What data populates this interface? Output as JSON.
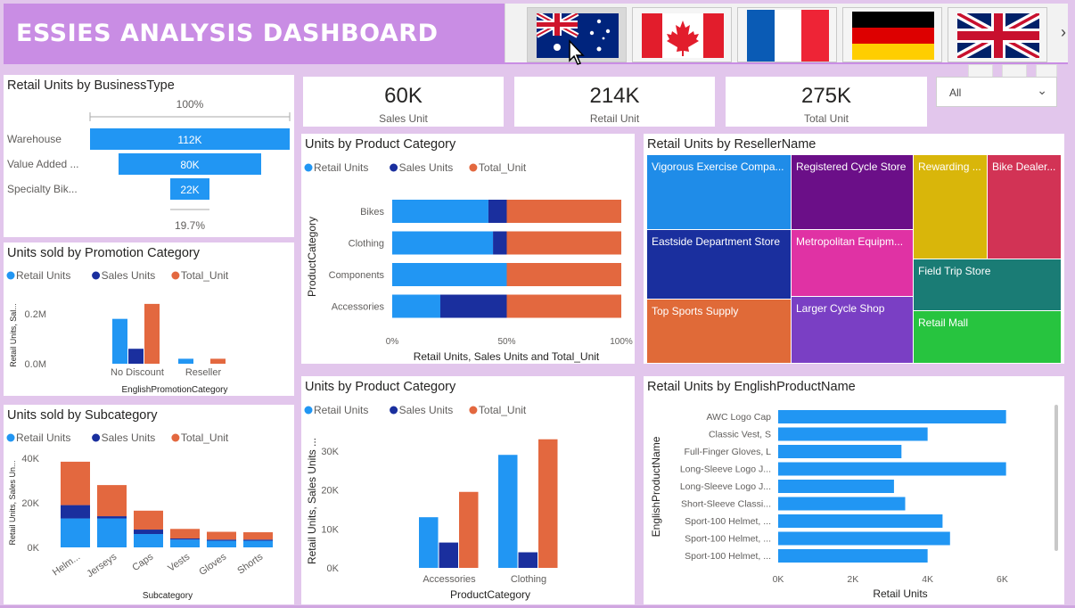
{
  "header": {
    "title": "ESSIES ANALYSIS DASHBOARD"
  },
  "flags": [
    {
      "name": "australia-flag",
      "selected": true
    },
    {
      "name": "canada-flag",
      "selected": false
    },
    {
      "name": "france-flag",
      "selected": false
    },
    {
      "name": "germany-flag",
      "selected": false
    },
    {
      "name": "uk-flag",
      "selected": false
    }
  ],
  "flags_next_icon": "chevron-right-icon",
  "kpis": [
    {
      "value": "60K",
      "label": "Sales Unit"
    },
    {
      "value": "214K",
      "label": "Retail Unit"
    },
    {
      "value": "275K",
      "label": "Total Unit"
    }
  ],
  "slicer": {
    "value": "All"
  },
  "colors": {
    "retail": "#2196f3",
    "sales": "#1a2f9e",
    "total": "#e3683f",
    "card": "#ffffff",
    "header": "#c98de4"
  },
  "legend": {
    "retail": "Retail Units",
    "sales": "Sales Units",
    "total": "Total_Unit"
  },
  "chart_data": [
    {
      "id": "funnel",
      "type": "funnel",
      "title": "Retail Units by BusinessType",
      "categories": [
        "Warehouse",
        "Value Added ...",
        "Specialty Bik..."
      ],
      "values": [
        112,
        80,
        22
      ],
      "value_labels": [
        "112K",
        "80K",
        "22K"
      ],
      "top_label": "100%",
      "bottom_label": "19.7%"
    },
    {
      "id": "promo",
      "type": "bar",
      "title": "Units sold by Promotion Category",
      "categories": [
        "No Discount",
        "Reseller"
      ],
      "series": [
        {
          "name": "Retail Units",
          "values": [
            0.18,
            0.02
          ]
        },
        {
          "name": "Sales Units",
          "values": [
            0.06,
            0.0
          ]
        },
        {
          "name": "Total_Unit",
          "values": [
            0.24,
            0.02
          ]
        }
      ],
      "yticks": [
        "0.0M",
        "0.2M"
      ],
      "ylim": [
        0,
        0.28
      ],
      "xlabel": "EnglishPromotionCategory",
      "ylabel": "Retail Units, Sal..."
    },
    {
      "id": "subcat",
      "type": "bar",
      "stacked": true,
      "title": "Units sold by Subcategory",
      "categories": [
        "Helm...",
        "Jerseys",
        "Caps",
        "Vests",
        "Gloves",
        "Shorts"
      ],
      "series": [
        {
          "name": "Retail Units",
          "values": [
            13000,
            13000,
            6000,
            3500,
            3000,
            3000
          ]
        },
        {
          "name": "Sales Units",
          "values": [
            6000,
            1000,
            2000,
            500,
            500,
            500
          ]
        },
        {
          "name": "Total_Unit",
          "values": [
            19500,
            14000,
            8500,
            4300,
            3500,
            3300
          ]
        }
      ],
      "yticks": [
        "0K",
        "20K",
        "40K"
      ],
      "ylim": [
        0,
        45000
      ],
      "xlabel": "Subcategory",
      "ylabel": "Retail Units, Sales Un..."
    },
    {
      "id": "cat100",
      "type": "bar",
      "orientation": "horizontal",
      "stacked": "100%",
      "title": "Units by Product Category",
      "categories": [
        "Bikes",
        "Clothing",
        "Components",
        "Accessories"
      ],
      "series": [
        {
          "name": "Retail Units",
          "values": [
            42,
            44,
            50,
            21
          ]
        },
        {
          "name": "Sales Units",
          "values": [
            8,
            6,
            0,
            29
          ]
        },
        {
          "name": "Total_Unit",
          "values": [
            50,
            50,
            50,
            50
          ]
        }
      ],
      "xticks": [
        "0%",
        "50%",
        "100%"
      ],
      "xlabel": "Retail Units, Sales Units and Total_Unit",
      "ylabel": "ProductCategory"
    },
    {
      "id": "treemap",
      "type": "treemap",
      "title": "Retail Units by ResellerName",
      "items": [
        {
          "label": "Vigorous Exercise Compa...",
          "color": "#1f8ce8"
        },
        {
          "label": "Eastside Department Store",
          "color": "#1a2f9e"
        },
        {
          "label": "Top Sports Supply",
          "color": "#e06a38"
        },
        {
          "label": "Registered Cycle Store",
          "color": "#6b0f88"
        },
        {
          "label": "Metropolitan Equipm...",
          "color": "#e032a4"
        },
        {
          "label": "Larger Cycle Shop",
          "color": "#7a3fc4"
        },
        {
          "label": "Rewarding ...",
          "color": "#d9b60a"
        },
        {
          "label": "Bike Dealer...",
          "color": "#d23355"
        },
        {
          "label": "Field Trip Store",
          "color": "#1a7c75"
        },
        {
          "label": "Retail Mall",
          "color": "#27c43f"
        }
      ]
    },
    {
      "id": "catcol",
      "type": "bar",
      "title": "Units by Product Category",
      "categories": [
        "Accessories",
        "Clothing"
      ],
      "series": [
        {
          "name": "Retail Units",
          "values": [
            13000,
            29000
          ]
        },
        {
          "name": "Sales Units",
          "values": [
            6500,
            4000
          ]
        },
        {
          "name": "Total_Unit",
          "values": [
            19500,
            33000
          ]
        }
      ],
      "yticks": [
        "0K",
        "10K",
        "20K",
        "30K"
      ],
      "ylim": [
        0,
        35000
      ],
      "xlabel": "ProductCategory",
      "ylabel": "Retail Units, Sales Units ..."
    },
    {
      "id": "product",
      "type": "bar",
      "orientation": "horizontal",
      "title": "Retail Units by EnglishProductName",
      "categories": [
        "AWC Logo Cap",
        "Classic Vest, S",
        "Full-Finger Gloves, L",
        "Long-Sleeve Logo J...",
        "Long-Sleeve Logo J...",
        "Short-Sleeve Classi...",
        "Sport-100 Helmet, ...",
        "Sport-100 Helmet, ...",
        "Sport-100 Helmet, ..."
      ],
      "values": [
        6100,
        4000,
        3300,
        6100,
        3100,
        3400,
        4400,
        4600,
        4000
      ],
      "xticks": [
        "0K",
        "2K",
        "4K",
        "6K"
      ],
      "xlim": [
        0,
        6800
      ],
      "xlabel": "Retail Units",
      "ylabel": "EnglishProductName"
    }
  ]
}
